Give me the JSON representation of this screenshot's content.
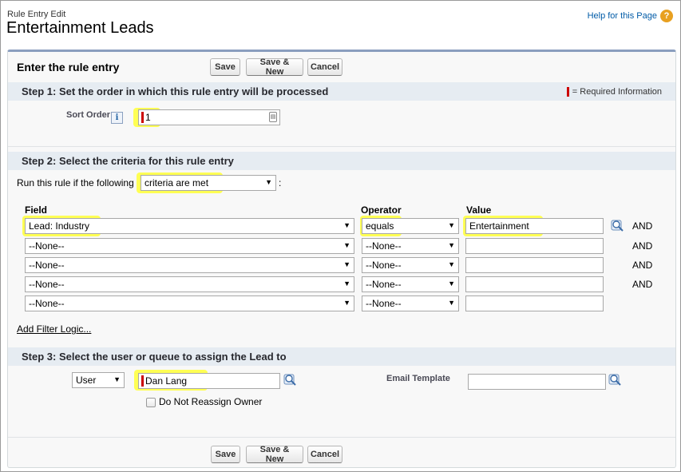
{
  "page": {
    "breadcrumb": "Rule Entry Edit",
    "title": "Entertainment Leads",
    "help_link": "Help for this Page",
    "help_icon": "?"
  },
  "panel": {
    "title": "Enter the rule entry",
    "buttons": {
      "save": "Save",
      "save_new": "Save & New",
      "cancel": "Cancel"
    }
  },
  "step1": {
    "title": "Step 1: Set the order in which this rule entry will be processed",
    "required_legend": "= Required Information",
    "sort_order_label": "Sort Order",
    "sort_order_info": "i",
    "sort_order_value": "1"
  },
  "step2": {
    "title": "Step 2: Select the criteria for this rule entry",
    "run_rule_prefix": "Run this rule if the following",
    "run_rule_suffix": ":",
    "criteria_selected": "criteria are met",
    "columns": {
      "field": "Field",
      "operator": "Operator",
      "value": "Value"
    },
    "rows": [
      {
        "field": "Lead: Industry",
        "operator": "equals",
        "value": "Entertainment",
        "conj": "AND"
      },
      {
        "field": "--None--",
        "operator": "--None--",
        "value": "",
        "conj": "AND"
      },
      {
        "field": "--None--",
        "operator": "--None--",
        "value": "",
        "conj": "AND"
      },
      {
        "field": "--None--",
        "operator": "--None--",
        "value": "",
        "conj": "AND"
      },
      {
        "field": "--None--",
        "operator": "--None--",
        "value": "",
        "conj": ""
      }
    ],
    "add_filter_logic": "Add Filter Logic..."
  },
  "step3": {
    "title": "Step 3: Select the user or queue to assign the Lead to",
    "assign_type": "User",
    "assignee": "Dan Lang",
    "do_not_reassign_label": "Do Not Reassign Owner",
    "email_template_label": "Email Template",
    "email_template_value": ""
  },
  "colors": {
    "highlight": "#ffff54",
    "required": "#cc0000",
    "section_bg": "#e6ecf2",
    "panel_border": "#8a9ebe",
    "link": "#015ba7"
  }
}
